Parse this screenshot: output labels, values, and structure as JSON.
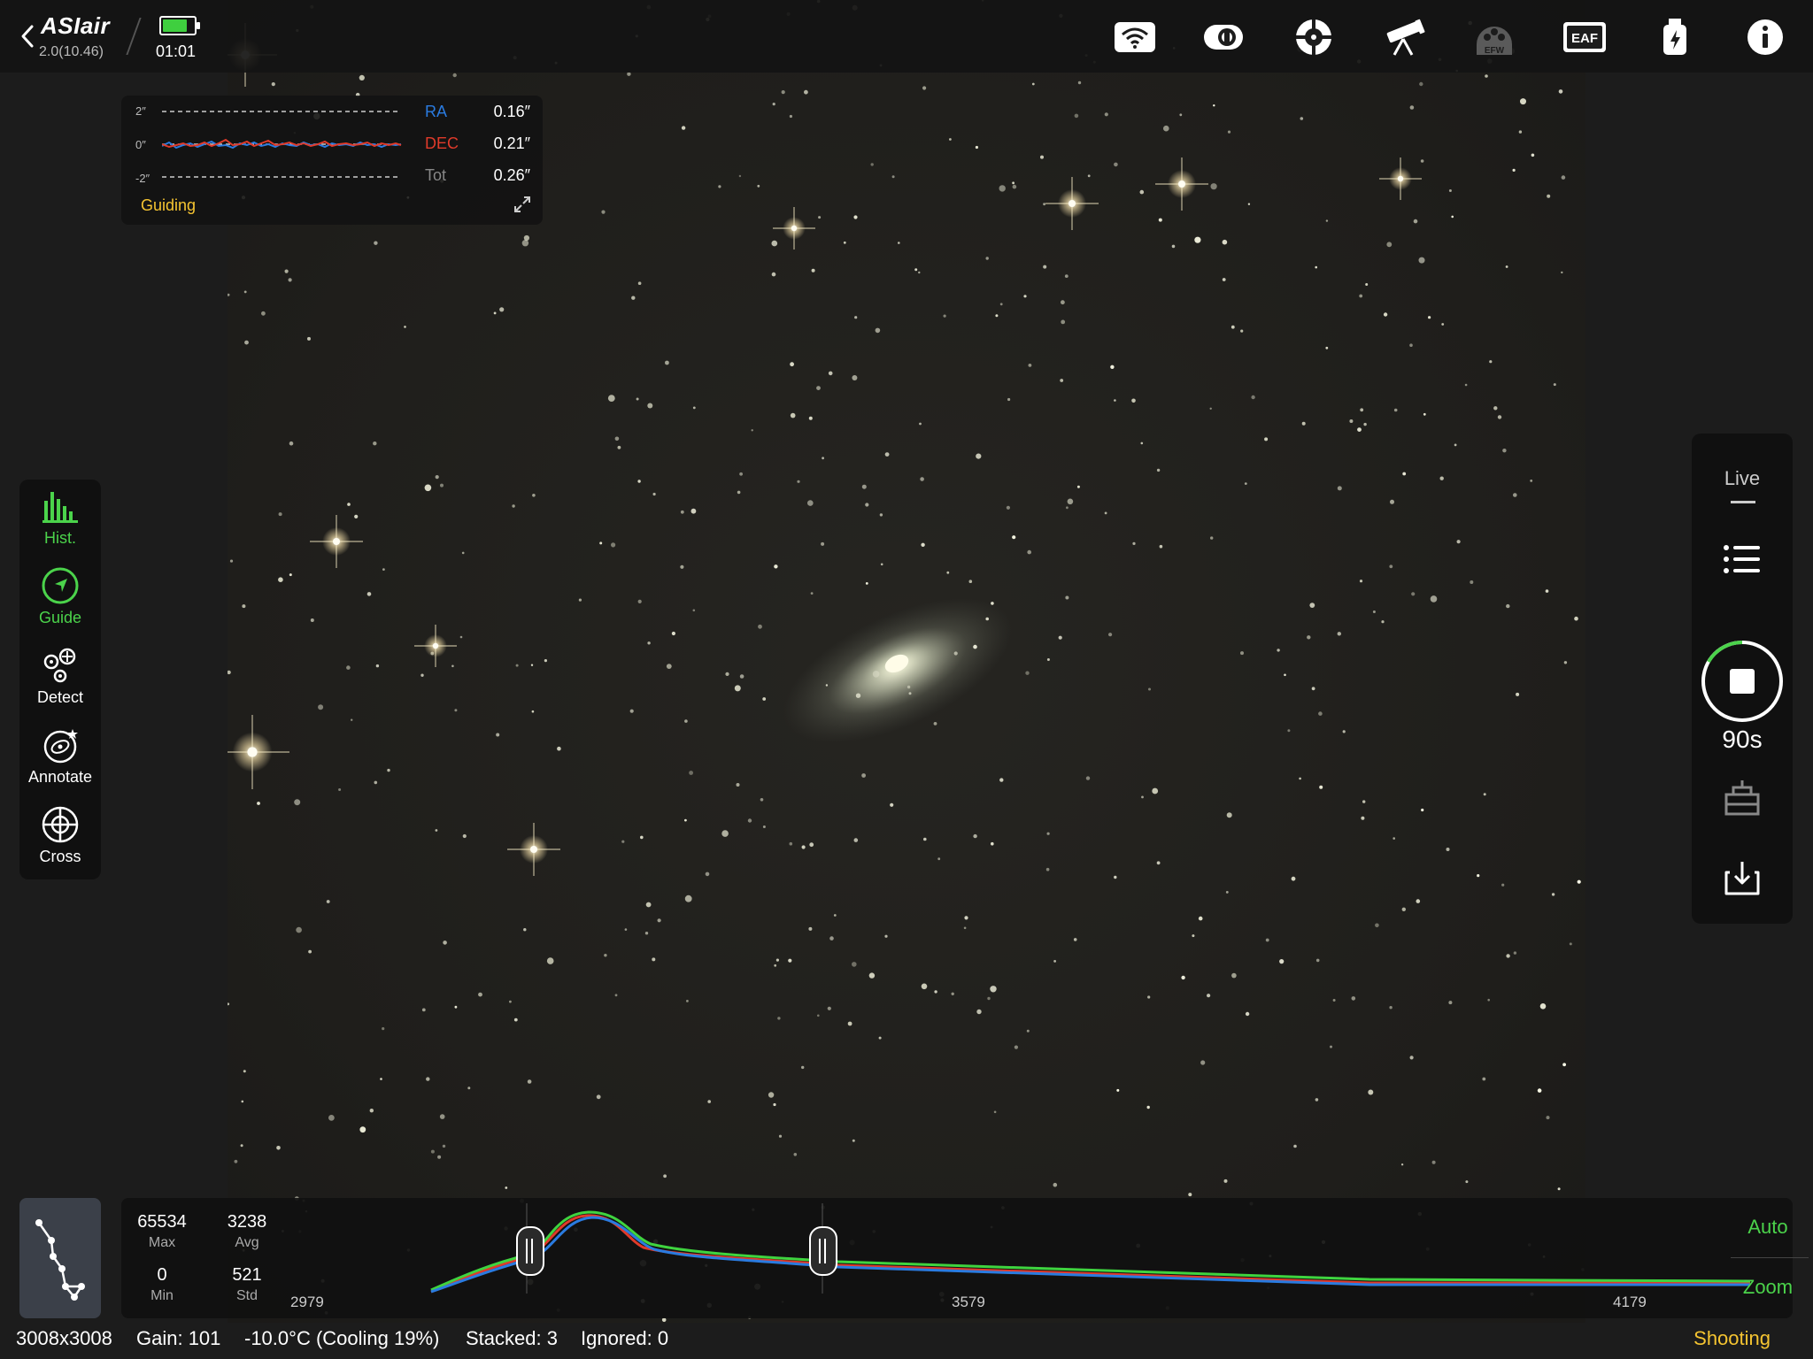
{
  "header": {
    "app_name": "ASIair",
    "version": "2.0(10.46)",
    "battery_level": 0.8,
    "clock": "01:01",
    "icons": [
      "wifi-icon",
      "camera-icon",
      "guide-scope-icon",
      "telescope-icon",
      "efw-icon",
      "eaf-icon",
      "usb-power-icon",
      "info-icon"
    ],
    "efw_label": "EFW",
    "eaf_label": "EAF"
  },
  "guiding": {
    "tick_top": "2″",
    "tick_mid": "0″",
    "tick_bot": "-2″",
    "ra_label": "RA",
    "ra_value": "0.16″",
    "dec_label": "DEC",
    "dec_value": "0.21″",
    "tot_label": "Tot",
    "tot_value": "0.26″",
    "status": "Guiding",
    "colors": {
      "ra": "#2a7be0",
      "dec": "#e03a2a",
      "status": "#f5c431"
    }
  },
  "left_tools": [
    {
      "label": "Hist.",
      "icon": "histogram-icon",
      "active": true
    },
    {
      "label": "Guide",
      "icon": "guide-icon",
      "active": true
    },
    {
      "label": "Detect",
      "icon": "detect-icon",
      "active": false
    },
    {
      "label": "Annotate",
      "icon": "annotate-icon",
      "active": false
    },
    {
      "label": "Cross",
      "icon": "crosshair-icon",
      "active": false
    }
  ],
  "right_panel": {
    "mode": "Live",
    "exposure": "90s",
    "icons": [
      "list-icon",
      "stop-icon",
      "calibration-icon",
      "download-icon"
    ]
  },
  "histogram": {
    "max_value": "65534",
    "max_label": "Max",
    "avg_value": "3238",
    "avg_label": "Avg",
    "min_value": "0",
    "min_label": "Min",
    "std_value": "521",
    "std_label": "Std",
    "axis_left": "2979",
    "axis_mid": "3579",
    "axis_right": "4179",
    "auto_label": "Auto",
    "zoom_label": "Zoom",
    "accent": "#4bd34b"
  },
  "status_bar": {
    "resolution": "3008x3008",
    "gain": "Gain: 101",
    "temperature": "-10.0°C (Cooling 19%)",
    "stacked": "Stacked: 3",
    "ignored": "Ignored: 0",
    "state": "Shooting"
  }
}
